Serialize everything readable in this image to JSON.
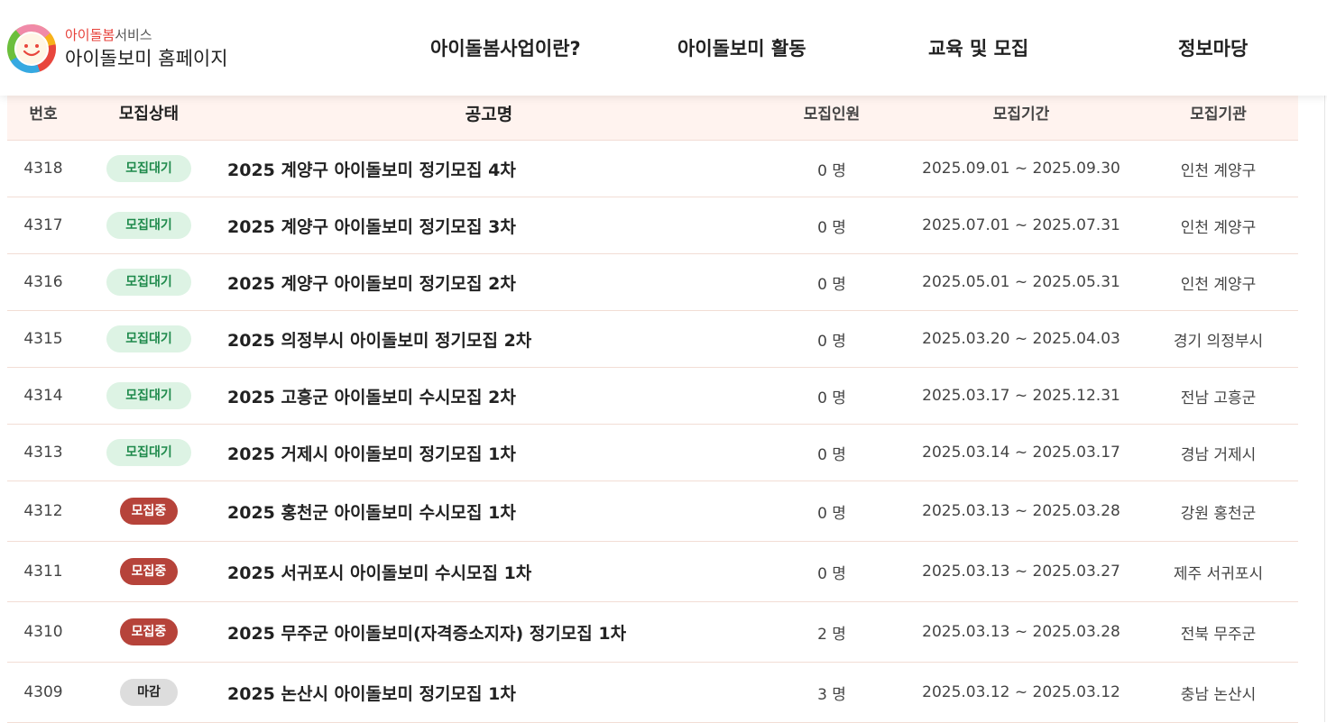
{
  "header": {
    "logo": {
      "accent": "아이돌봄",
      "top_rest": "서비스",
      "main": "아이돌보미 홈페이지",
      "icon": "smiley-face-logo"
    },
    "nav": [
      {
        "label": "아이돌봄사업이란?"
      },
      {
        "label": "아이돌보미 활동"
      },
      {
        "label": "교육 및 모집"
      },
      {
        "label": "정보마당"
      }
    ]
  },
  "table": {
    "columns": [
      "번호",
      "모집상태",
      "공고명",
      "모집인원",
      "모집기간",
      "모집기관"
    ],
    "rows": [
      {
        "no": "4318",
        "status": "모집대기",
        "title": "2025 계양구 아이돌보미 정기모집 4차",
        "count": "0 명",
        "period": "2025.09.01 ~ 2025.09.30",
        "org": "인천 계양구"
      },
      {
        "no": "4317",
        "status": "모집대기",
        "title": "2025 계양구 아이돌보미 정기모집 3차",
        "count": "0 명",
        "period": "2025.07.01 ~ 2025.07.31",
        "org": "인천 계양구"
      },
      {
        "no": "4316",
        "status": "모집대기",
        "title": "2025 계양구 아이돌보미 정기모집 2차",
        "count": "0 명",
        "period": "2025.05.01 ~ 2025.05.31",
        "org": "인천 계양구"
      },
      {
        "no": "4315",
        "status": "모집대기",
        "title": "2025 의정부시 아이돌보미 정기모집 2차",
        "count": "0 명",
        "period": "2025.03.20 ~ 2025.04.03",
        "org": "경기 의정부시"
      },
      {
        "no": "4314",
        "status": "모집대기",
        "title": "2025 고흥군 아이돌보미 수시모집 2차",
        "count": "0 명",
        "period": "2025.03.17 ~ 2025.12.31",
        "org": "전남 고흥군"
      },
      {
        "no": "4313",
        "status": "모집대기",
        "title": "2025 거제시 아이돌보미 정기모집 1차",
        "count": "0 명",
        "period": "2025.03.14 ~ 2025.03.17",
        "org": "경남 거제시"
      },
      {
        "no": "4312",
        "status": "모집중",
        "title": "2025 홍천군 아이돌보미 수시모집 1차",
        "count": "0 명",
        "period": "2025.03.13 ~ 2025.03.28",
        "org": "강원 홍천군"
      },
      {
        "no": "4311",
        "status": "모집중",
        "title": "2025 서귀포시 아이돌보미 수시모집 1차",
        "count": "0 명",
        "period": "2025.03.13 ~ 2025.03.27",
        "org": "제주 서귀포시"
      },
      {
        "no": "4310",
        "status": "모집중",
        "title": "2025 무주군 아이돌보미(자격증소지자) 정기모집 1차",
        "count": "2 명",
        "period": "2025.03.13 ~ 2025.03.28",
        "org": "전북 무주군"
      },
      {
        "no": "4309",
        "status": "마감",
        "title": "2025 논산시 아이돌보미 정기모집 1차",
        "count": "3 명",
        "period": "2025.03.12 ~ 2025.03.12",
        "org": "충남 논산시"
      }
    ]
  },
  "colors": {
    "status_wait_bg": "#ddf3e4",
    "status_wait_text": "#1f8a4c",
    "status_open_bg": "#b6433a",
    "status_closed_bg": "#dddddd",
    "header_row_bg": "#fff3ef",
    "logo_accent": "#e7423b"
  }
}
